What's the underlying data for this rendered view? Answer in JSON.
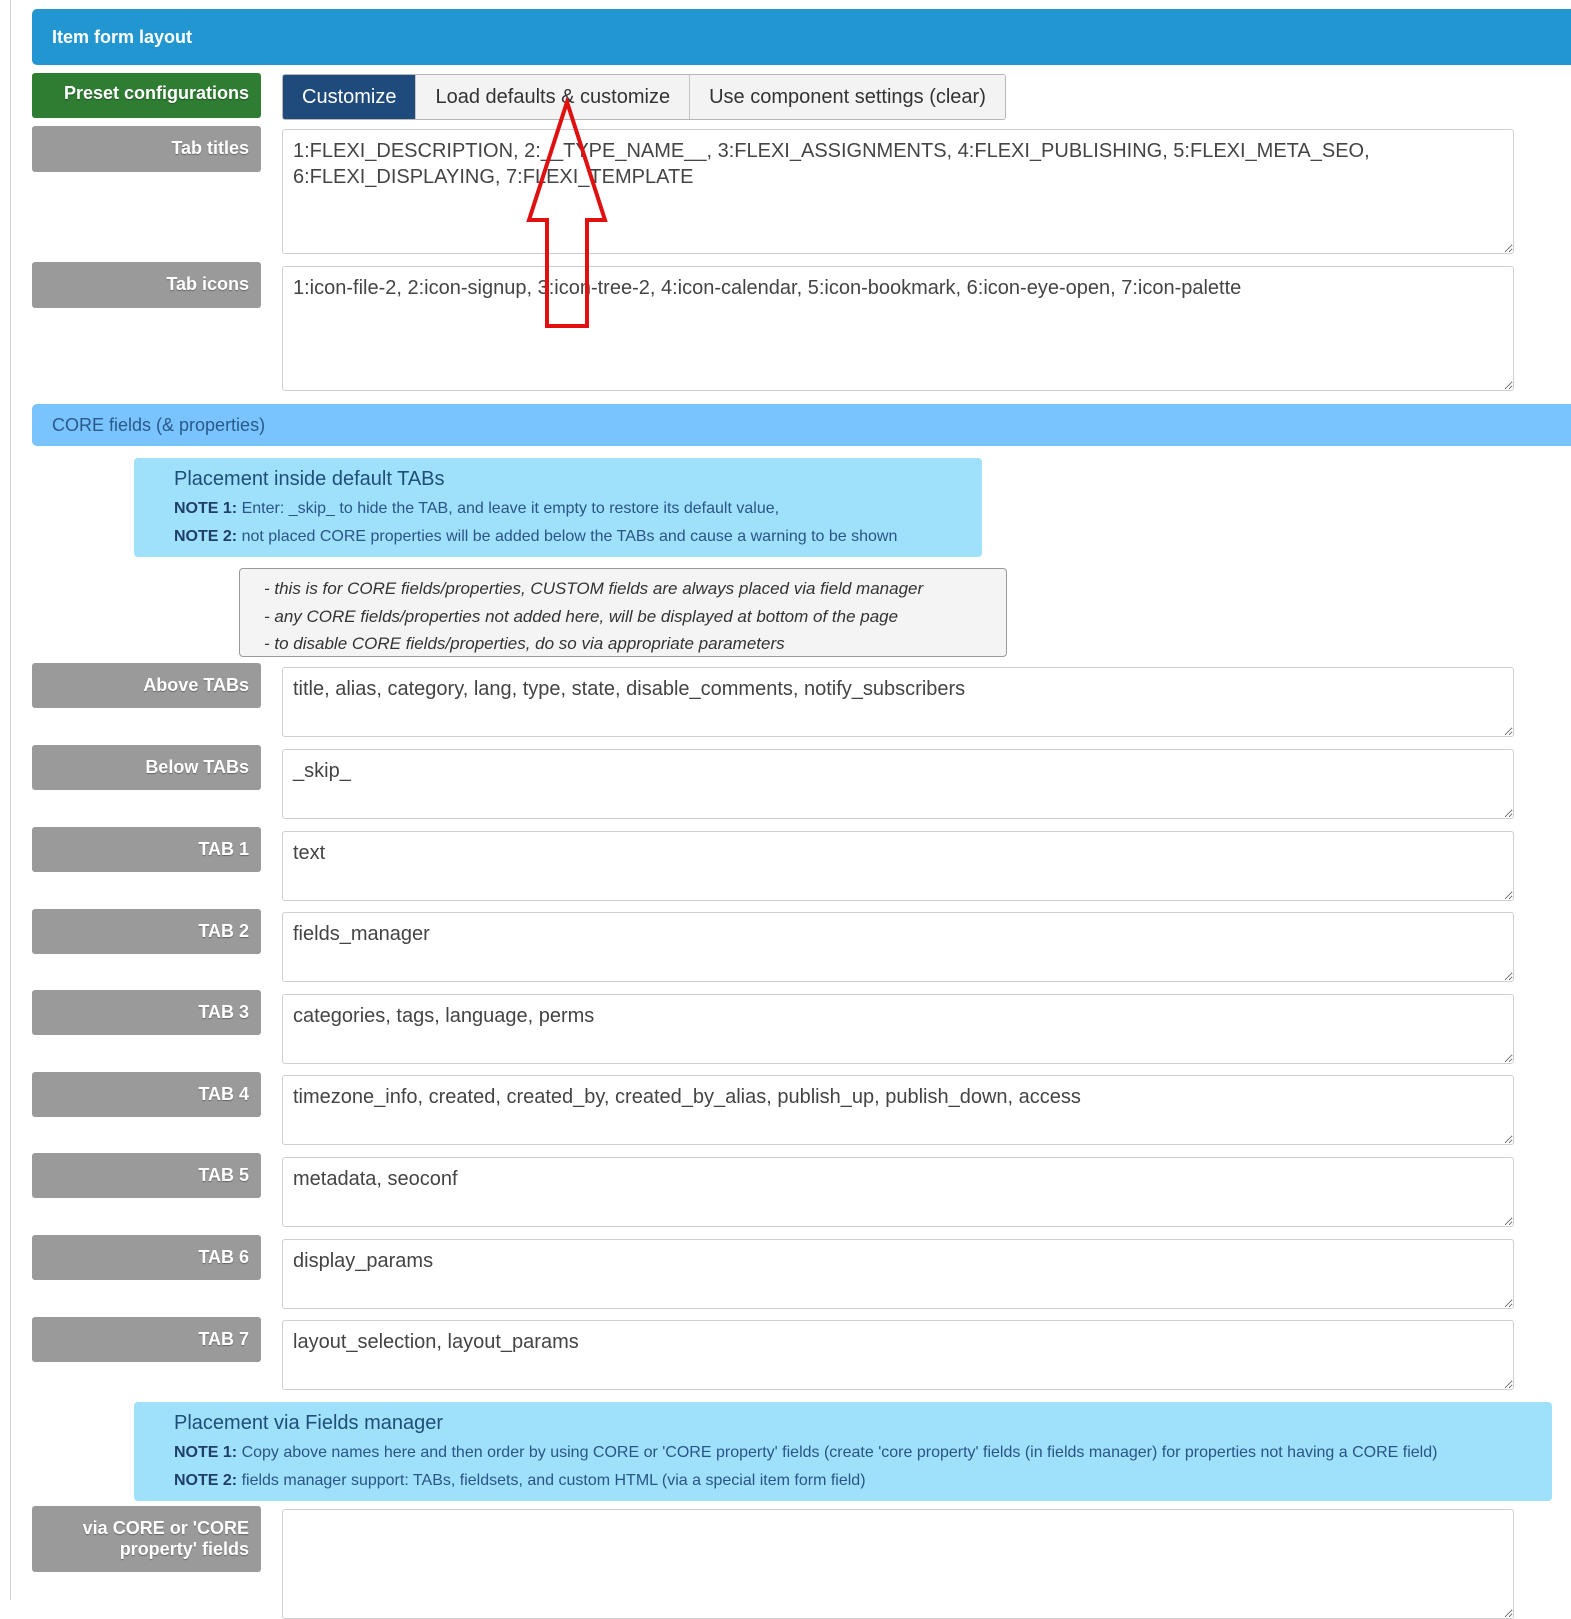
{
  "header": {
    "title": "Item form layout"
  },
  "preset": {
    "label": "Preset configurations",
    "buttons": [
      "Customize",
      "Load defaults & customize",
      "Use component settings (clear)"
    ]
  },
  "tab_titles": {
    "label": "Tab titles",
    "value": "1:FLEXI_DESCRIPTION, 2:__TYPE_NAME__, 3:FLEXI_ASSIGNMENTS, 4:FLEXI_PUBLISHING, 5:FLEXI_META_SEO, 6:FLEXI_DISPLAYING, 7:FLEXI_TEMPLATE"
  },
  "tab_icons": {
    "label": "Tab icons",
    "value": "1:icon-file-2, 2:icon-signup, 3:icon-tree-2, 4:icon-calendar, 5:icon-bookmark, 6:icon-eye-open, 7:icon-palette"
  },
  "core_section": {
    "title": "CORE fields (& properties)"
  },
  "placement_default": {
    "title": "Placement inside default TABs",
    "note1_label": "NOTE 1:",
    "note1_text": " Enter: _skip_ to hide the TAB, and leave it empty to restore its default value,",
    "note2_label": "NOTE 2:",
    "note2_text": " not placed CORE properties will be added below the TABs and cause a warning to be shown"
  },
  "tips": [
    "- this is for CORE fields/properties, CUSTOM fields are always placed via field manager",
    "- any CORE fields/properties not added here, will be displayed at bottom of the page",
    "- to disable CORE fields/properties, do so via appropriate parameters"
  ],
  "fields": [
    {
      "label": "Above TABs",
      "value": "title, alias, category, lang, type, state, disable_comments, notify_subscribers"
    },
    {
      "label": "Below TABs",
      "value": "_skip_"
    },
    {
      "label": "TAB 1",
      "value": "text"
    },
    {
      "label": "TAB 2",
      "value": "fields_manager"
    },
    {
      "label": "TAB 3",
      "value": "categories, tags, language, perms"
    },
    {
      "label": "TAB 4",
      "value": "timezone_info, created, created_by, created_by_alias, publish_up, publish_down, access"
    },
    {
      "label": "TAB 5",
      "value": "metadata, seoconf"
    },
    {
      "label": "TAB 6",
      "value": "display_params"
    },
    {
      "label": "TAB 7",
      "value": "layout_selection, layout_params"
    }
  ],
  "placement_manager": {
    "title": "Placement via Fields manager",
    "note1_label": "NOTE 1:",
    "note1_text": " Copy above names here and then order by using CORE or 'CORE property' fields (create 'core property' fields (in fields manager) for properties not having a CORE field)",
    "note2_label": "NOTE 2:",
    "note2_text": " fields manager support: TABs, fieldsets, and custom HTML (via a special item form field)"
  },
  "via_core": {
    "label": "via CORE or 'CORE property' fields",
    "value": ""
  },
  "colors": {
    "header": "#2196d0",
    "section": "#79c3ff",
    "info": "#9fe0fb",
    "label_gray": "#9a9a9a",
    "label_green": "#2f7d32",
    "active_button": "#1e4a7c",
    "arrow": "#e01010"
  },
  "icons": {
    "annotation": "red-arrow-up-icon"
  }
}
